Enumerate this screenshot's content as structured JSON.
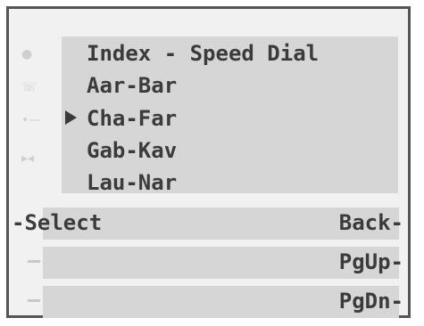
{
  "menu": {
    "title": "Index - Speed Dial",
    "items": [
      {
        "label": "Aar-Bar"
      },
      {
        "label": "Cha-Far"
      },
      {
        "label": "Gab-Kav"
      },
      {
        "label": "Lau-Nar"
      }
    ],
    "selected_label": "Cha-Far"
  },
  "softkeys": {
    "left_1": "-Select",
    "right_1": "Back-",
    "right_2": "PgUp-",
    "right_3": "PgDn-"
  },
  "status_icons": [
    "dot-icon",
    "phone-icon",
    "line-icon",
    "connector-icon"
  ]
}
